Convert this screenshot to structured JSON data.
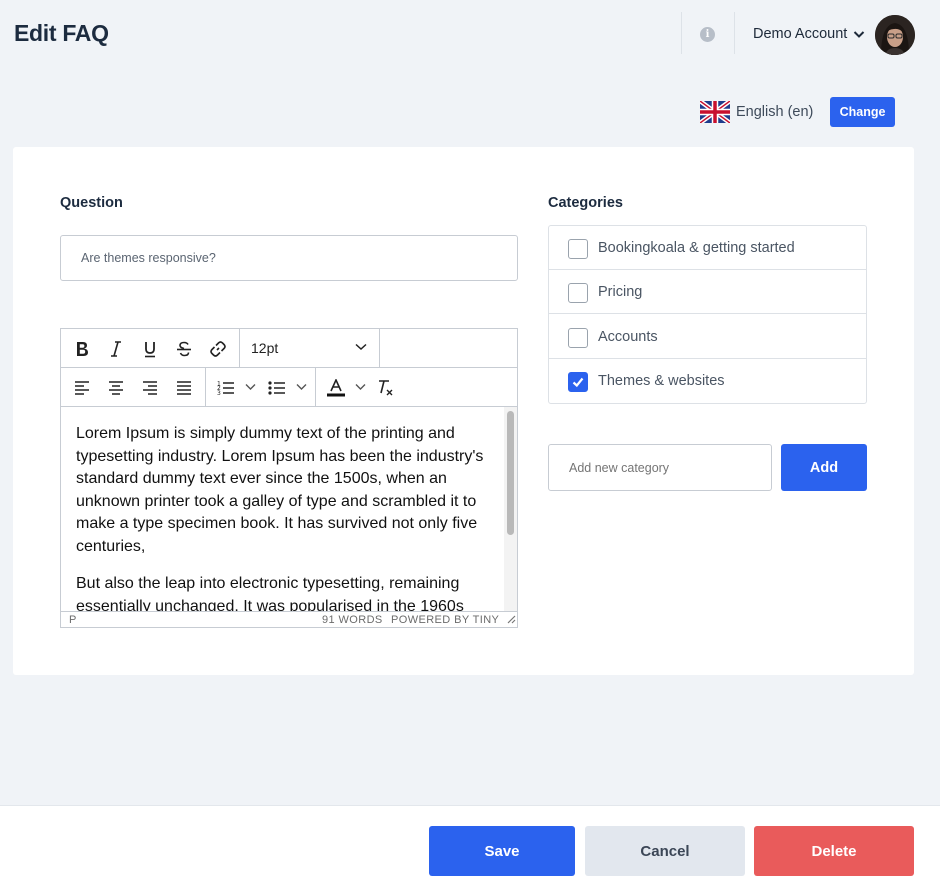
{
  "header": {
    "title": "Edit FAQ",
    "account_name": "Demo Account",
    "info_icon": "info-icon",
    "account_chevron_icon": "chevron-down-icon"
  },
  "language": {
    "label": "English (en)",
    "flag_icon": "uk-flag-icon",
    "change_label": "Change"
  },
  "question": {
    "heading": "Question",
    "value": "Are themes responsive?"
  },
  "editor": {
    "toolbar_row1": [
      "bold-icon",
      "italic-icon",
      "underline-icon",
      "strikethrough-icon",
      "link-icon"
    ],
    "font_size": "12pt",
    "toolbar_row2": [
      "align-left-icon",
      "align-center-icon",
      "align-right-icon",
      "align-justify-icon",
      "numbered-list-icon",
      "bullet-list-icon",
      "text-color-icon",
      "clear-formatting-icon"
    ],
    "paragraphs": [
      "Lorem Ipsum is simply dummy text of the printing and typesetting industry. Lorem Ipsum has been the industry's standard dummy text ever since the 1500s, when an unknown printer took a galley of type and scrambled it to make a type specimen book. It has survived not only five centuries,",
      "But also the leap into electronic typesetting, remaining essentially unchanged. It was popularised in the 1960s"
    ],
    "status_path": "P",
    "word_count": "91 WORDS",
    "powered_by": "POWERED BY TINY"
  },
  "categories": {
    "heading": "Categories",
    "items": [
      {
        "label": "Bookingkoala & getting started",
        "checked": false
      },
      {
        "label": "Pricing",
        "checked": false
      },
      {
        "label": "Accounts",
        "checked": false
      },
      {
        "label": "Themes & websites",
        "checked": true
      }
    ],
    "new_placeholder": "Add new category",
    "add_label": "Add"
  },
  "footer": {
    "save_label": "Save",
    "cancel_label": "Cancel",
    "delete_label": "Delete"
  },
  "colors": {
    "primary": "#2b62ee",
    "danger": "#e95b5b",
    "secondary": "#e2e7ee",
    "background": "#f0f3f7"
  }
}
